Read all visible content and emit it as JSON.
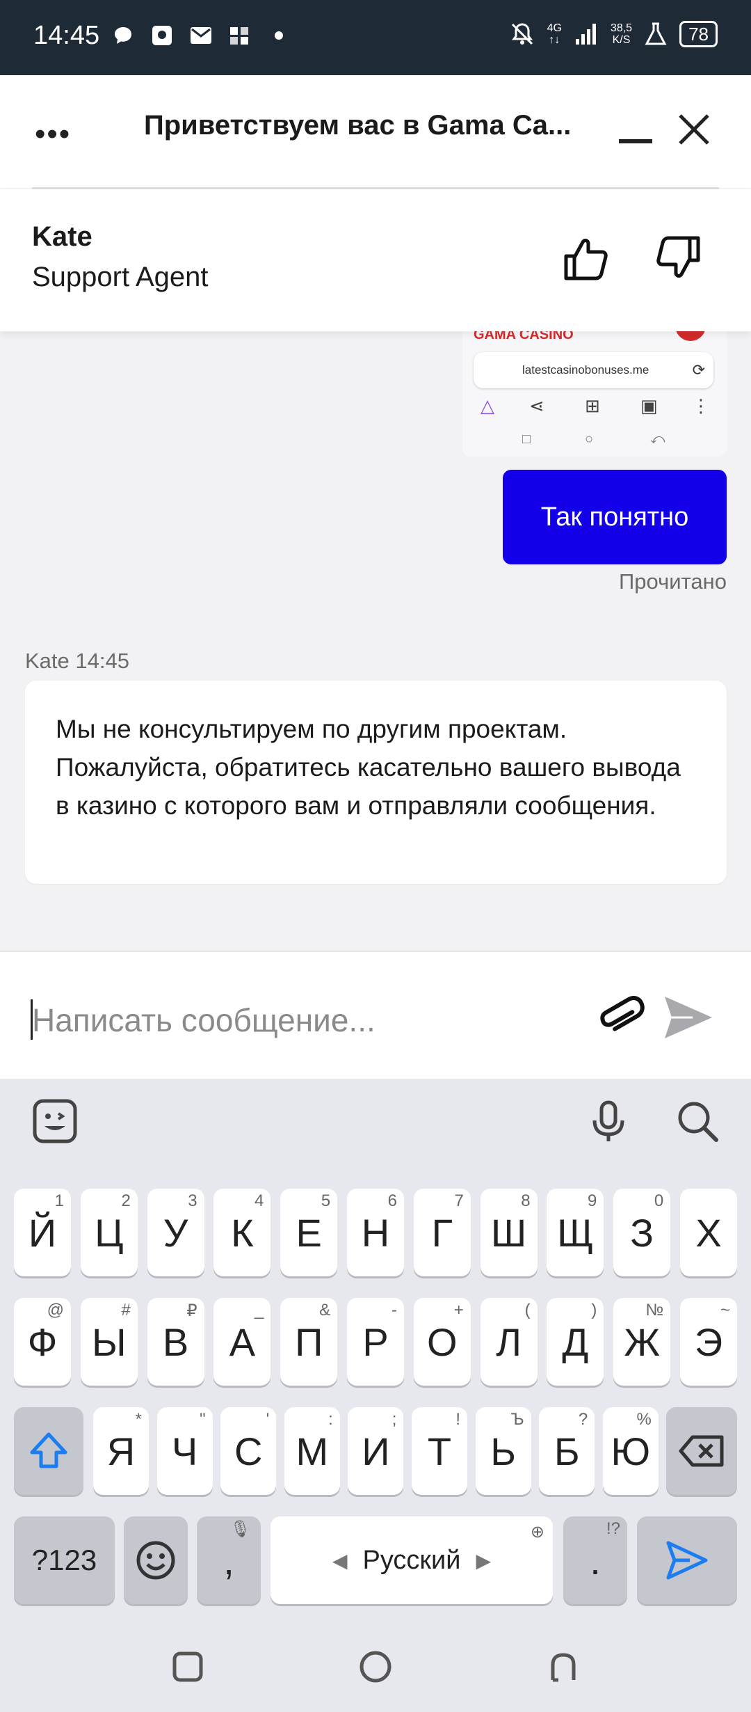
{
  "status_bar": {
    "time": "14:45",
    "icons": [
      "chat-bubble-icon",
      "sim-toolkit-icon",
      "mail-icon",
      "app-icon",
      "dot-icon"
    ],
    "right_icons": [
      "bell-off-icon",
      "signal-icon",
      "flask-icon"
    ],
    "network": "4G",
    "speed_value": "38,5",
    "speed_unit": "K/S",
    "battery": "78"
  },
  "header": {
    "title": "Приветствуем вас в Gama Ca...",
    "menu_label": "•••"
  },
  "agent": {
    "name": "Kate",
    "role": "Support Agent"
  },
  "chat": {
    "image_preview": {
      "brand_text": "GAMA CASINO",
      "url": "latestcasinobonuses.me"
    },
    "sent_message": "Так понятно",
    "read_status": "Прочитано",
    "agent_label": "Kate 14:45",
    "agent_message": "Мы не консультируем по другим проектам. Пожалуйста, обратитесь касательно вашего вывода в казино с которого вам и отправляли сообщения."
  },
  "input": {
    "placeholder": "Написать сообщение..."
  },
  "keyboard": {
    "row1": [
      {
        "k": "Й",
        "h": "1"
      },
      {
        "k": "Ц",
        "h": "2"
      },
      {
        "k": "У",
        "h": "3"
      },
      {
        "k": "К",
        "h": "4"
      },
      {
        "k": "Е",
        "h": "5"
      },
      {
        "k": "Н",
        "h": "6"
      },
      {
        "k": "Г",
        "h": "7"
      },
      {
        "k": "Ш",
        "h": "8"
      },
      {
        "k": "Щ",
        "h": "9"
      },
      {
        "k": "З",
        "h": "0"
      },
      {
        "k": "Х",
        "h": ""
      }
    ],
    "row2": [
      {
        "k": "Ф",
        "h": "@"
      },
      {
        "k": "Ы",
        "h": "#"
      },
      {
        "k": "В",
        "h": "₽"
      },
      {
        "k": "А",
        "h": "_"
      },
      {
        "k": "П",
        "h": "&"
      },
      {
        "k": "Р",
        "h": "-"
      },
      {
        "k": "О",
        "h": "+"
      },
      {
        "k": "Л",
        "h": "("
      },
      {
        "k": "Д",
        "h": ")"
      },
      {
        "k": "Ж",
        "h": "№"
      },
      {
        "k": "Э",
        "h": "~"
      }
    ],
    "row3": [
      {
        "k": "Я",
        "h": "*"
      },
      {
        "k": "Ч",
        "h": "\""
      },
      {
        "k": "С",
        "h": "'"
      },
      {
        "k": "М",
        "h": ":"
      },
      {
        "k": "И",
        "h": ";"
      },
      {
        "k": "Т",
        "h": "!"
      },
      {
        "k": "Ь",
        "h": "Ъ"
      },
      {
        "k": "Б",
        "h": "?"
      },
      {
        "k": "Ю",
        "h": "%"
      }
    ],
    "symbols_key": "?123",
    "comma_key": ",",
    "space_label": "Русский",
    "period_key": ".",
    "period_hint": "!?"
  }
}
